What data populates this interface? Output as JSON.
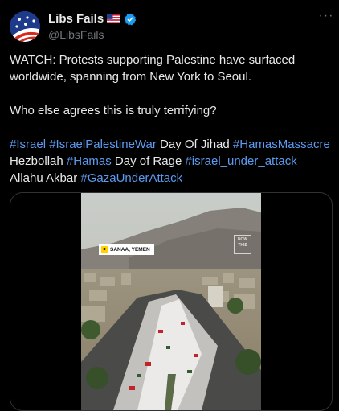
{
  "author": {
    "display_name": "Libs Fails",
    "handle": "@LibsFails",
    "flag_icon": "us-flag-icon",
    "verified_icon": "verified-badge-icon",
    "verified_color": "#1d9bf0"
  },
  "menu": {
    "more_label": "···"
  },
  "tweet": {
    "line1": "WATCH: Protests supporting Palestine have surfaced worldwide, spanning from New York to Seoul.",
    "line2": "Who else agrees this is truly terrifying?",
    "hashtags_block": [
      {
        "text": "#Israel",
        "tag": true
      },
      {
        "text": " ",
        "tag": false
      },
      {
        "text": "#IsraelPalestineWar",
        "tag": true
      },
      {
        "text": " Day Of Jihad ",
        "tag": false
      },
      {
        "text": "#HamasMassacre",
        "tag": true
      },
      {
        "text": " Hezbollah ",
        "tag": false
      },
      {
        "text": "#Hamas",
        "tag": true
      },
      {
        "text": " Day of Rage ",
        "tag": false
      },
      {
        "text": "#israel_under_attack",
        "tag": true
      },
      {
        "text": " Allahu Akbar ",
        "tag": false
      },
      {
        "text": "#GazaUnderAttack",
        "tag": true
      }
    ],
    "link_color": "#5b9bf0"
  },
  "media": {
    "location_label": "SANAA, YEMEN",
    "location_icon": "location-pin-icon",
    "watermark": "NOW THIS"
  }
}
